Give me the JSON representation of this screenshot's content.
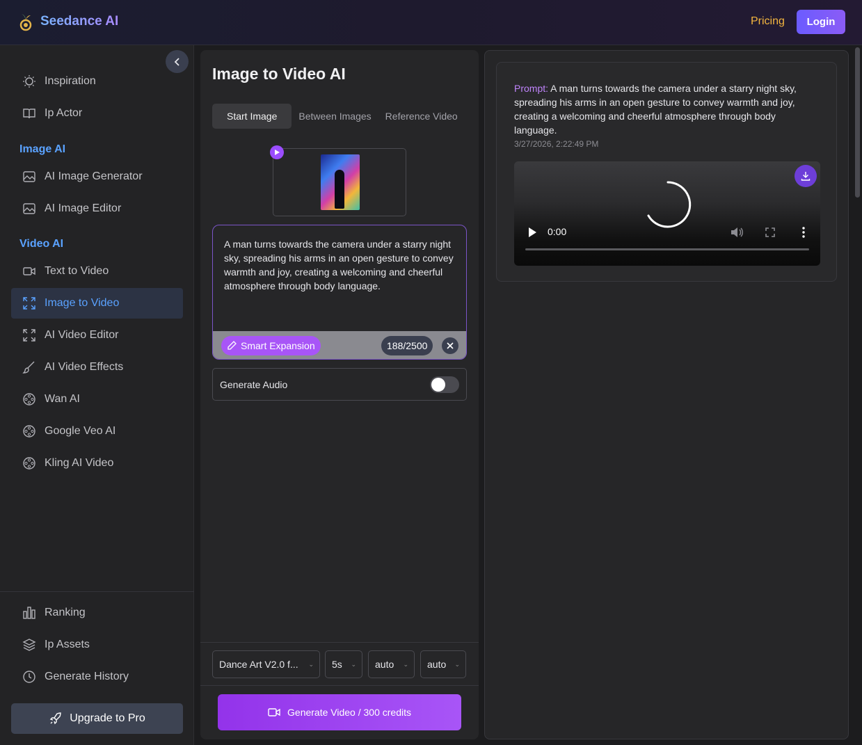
{
  "header": {
    "brand": "Seedance AI",
    "pricing_label": "Pricing",
    "login_label": "Login"
  },
  "sidebar": {
    "top_items": [
      {
        "label": "Inspiration",
        "icon": "lightbulb-icon"
      },
      {
        "label": "Ip Actor",
        "icon": "book-icon"
      }
    ],
    "image_section_title": "Image AI",
    "image_items": [
      {
        "label": "AI Image Generator",
        "icon": "image-icon"
      },
      {
        "label": "AI Image Editor",
        "icon": "image-icon"
      }
    ],
    "video_section_title": "Video AI",
    "video_items": [
      {
        "label": "Text to Video",
        "icon": "video-camera-icon"
      },
      {
        "label": "Image to Video",
        "icon": "expand-icon",
        "active": true
      },
      {
        "label": "AI Video Editor",
        "icon": "expand-icon"
      },
      {
        "label": "AI Video Effects",
        "icon": "brush-icon"
      },
      {
        "label": "Wan AI",
        "icon": "film-reel-icon"
      },
      {
        "label": "Google Veo AI",
        "icon": "film-reel-icon"
      },
      {
        "label": "Kling AI Video",
        "icon": "film-reel-icon"
      }
    ],
    "bottom_items": [
      {
        "label": "Ranking",
        "icon": "bar-chart-icon"
      },
      {
        "label": "Ip Assets",
        "icon": "layers-icon"
      },
      {
        "label": "Generate History",
        "icon": "clock-icon"
      }
    ],
    "upgrade_label": "Upgrade to Pro"
  },
  "main": {
    "title": "Image to Video AI",
    "tabs": [
      {
        "label": "Start Image",
        "active": true
      },
      {
        "label": "Between Images"
      },
      {
        "label": "Reference Video"
      }
    ],
    "prompt_text": "A man turns towards the camera under a starry night sky, spreading his arms in an open gesture to convey warmth and joy, creating a welcoming and cheerful atmosphere through body language.",
    "smart_expansion_label": "Smart Expansion",
    "char_count": "188/2500",
    "audio_label": "Generate Audio",
    "audio_enabled": false,
    "model_select": "Dance Art V2.0 f...",
    "duration_select": "5s",
    "ratio_select": "auto",
    "resolution_select": "auto",
    "generate_label": "Generate Video / 300 credits"
  },
  "result": {
    "prompt_key": "Prompt:",
    "prompt_text": "A man turns towards the camera under a starry night sky, spreading his arms in an open gesture to convey warmth and joy, creating a welcoming and cheerful atmosphere through body language.",
    "timestamp": "3/27/2026, 2:22:49 PM",
    "video_time": "0:00"
  },
  "colors": {
    "accent": "#a855f7",
    "link_blue": "#5aa2ff",
    "pricing": "#f3b53f"
  }
}
